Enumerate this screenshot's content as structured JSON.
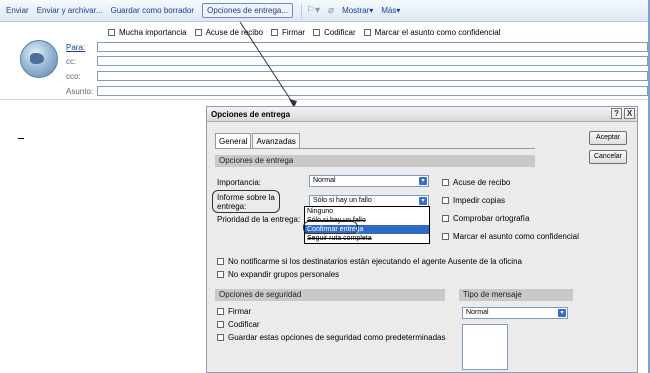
{
  "toolbar": {
    "send": "Enviar",
    "send_archive": "Enviar y archivar...",
    "save_draft": "Guardar como borrador",
    "delivery_options": "Opciones de entrega...",
    "show": "Mostrar",
    "more": "Más"
  },
  "options_row": {
    "high_importance": "Mucha importancia",
    "read_receipt": "Acuse de recibo",
    "sign": "Firmar",
    "encrypt": "Codificar",
    "mark_confidential": "Marcar el asunto como confidencial"
  },
  "header": {
    "to": "Para:",
    "cc": "cc:",
    "bcc": "cco:",
    "subject": "Asunto:"
  },
  "dialog": {
    "title": "Opciones de entrega",
    "help": "?",
    "close": "X",
    "tabs": [
      "General",
      "Avanzadas"
    ],
    "accept": "Aceptar",
    "cancel": "Cancelar",
    "delivery_section": "Opciones de entrega",
    "importance_label": "Importancia:",
    "importance_value": "Normal",
    "report_label_1": "Informe sobre la",
    "report_label_2": "entrega:",
    "report_value": "Sólo si hay un fallo",
    "priority_label": "Prioridad de la entrega:",
    "report_options": [
      "Ninguno",
      "Sólo si hay un fallo",
      "Confirmar entrega",
      "Seguir ruta completa"
    ],
    "report_selected_index": 2,
    "read_receipt": "Acuse de recibo",
    "prevent_copies": "Impedir copias",
    "spell_check": "Comprobar ortografía",
    "mark_confidential": "Marcar el asunto como confidencial",
    "no_notify_absent": "No notificarme si los destinatarios están ejecutando el agente Ausente de la oficina",
    "no_expand_groups": "No expandir grupos personales",
    "security_section": "Opciones de seguridad",
    "sign": "Firmar",
    "encrypt": "Codificar",
    "save_security_default": "Guardar estas opciones de seguridad como predeterminadas",
    "message_type_section": "Tipo de mensaje",
    "message_type_value": "Normal"
  },
  "colors": {
    "toolbar_text": "#15428b",
    "selection": "#316ac5",
    "section_bg": "#c9c9c9"
  }
}
